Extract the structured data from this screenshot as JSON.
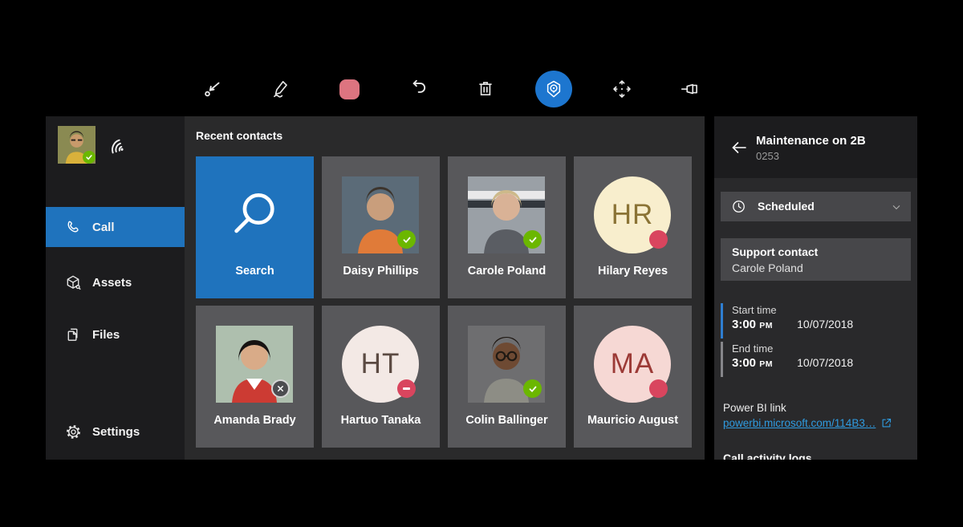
{
  "toolbar": {
    "tools": [
      "arrow-annotation",
      "ink-pen",
      "color-swatch",
      "undo",
      "erase-all",
      "hologram",
      "move",
      "pin"
    ],
    "active_tool": "hologram"
  },
  "colors": {
    "accent_blue": "#1f73bd",
    "toolbar_button_blue": "#1d76cf",
    "link_blue": "#2f9be0",
    "presence_available": "#6bb700",
    "presence_busy": "#d9455e",
    "ink_swatch": "#dd7480",
    "start_time_accent": "#2e7ed1"
  },
  "sidebar": {
    "items": [
      {
        "label": "Call",
        "active": true
      },
      {
        "label": "Assets",
        "active": false
      },
      {
        "label": "Files",
        "active": false
      },
      {
        "label": "Settings",
        "active": false
      }
    ],
    "user_presence": "available"
  },
  "main": {
    "title": "Recent contacts",
    "tiles": [
      {
        "label": "Search",
        "type": "search"
      },
      {
        "name": "Daisy Phillips",
        "presence": "available",
        "avatar": "photo"
      },
      {
        "name": "Carole Poland",
        "presence": "available",
        "avatar": "photo"
      },
      {
        "name": "Hilary Reyes",
        "presence": "busy",
        "initials": "HR",
        "style": "background:#f8eecd;color:#8a7335"
      },
      {
        "name": "Amanda Brady",
        "presence": "offline",
        "avatar": "photo"
      },
      {
        "name": "Hartuo Tanaka",
        "presence": "do-not-disturb",
        "initials": "HT",
        "style": "background:#f3e9e5;color:#5b4a42"
      },
      {
        "name": "Colin Ballinger",
        "presence": "available",
        "avatar": "photo"
      },
      {
        "name": "Mauricio August",
        "presence": "busy",
        "initials": "MA",
        "style": "background:#f6d8d4;color:#9c3a36"
      }
    ]
  },
  "panel": {
    "title": "Maintenance on 2B",
    "work_order_id": "0253",
    "status": "Scheduled",
    "support_contact_label": "Support contact",
    "support_contact_name": "Carole Poland",
    "start": {
      "label": "Start time",
      "time": "3:00",
      "meridiem": "PM",
      "date": "10/07/2018"
    },
    "end": {
      "label": "End time",
      "time": "3:00",
      "meridiem": "PM",
      "date": "10/07/2018"
    },
    "powerbi_label": "Power BI link",
    "powerbi_link": "powerbi.microsoft.com/114B3…",
    "footer_link": "Call activity logs"
  }
}
